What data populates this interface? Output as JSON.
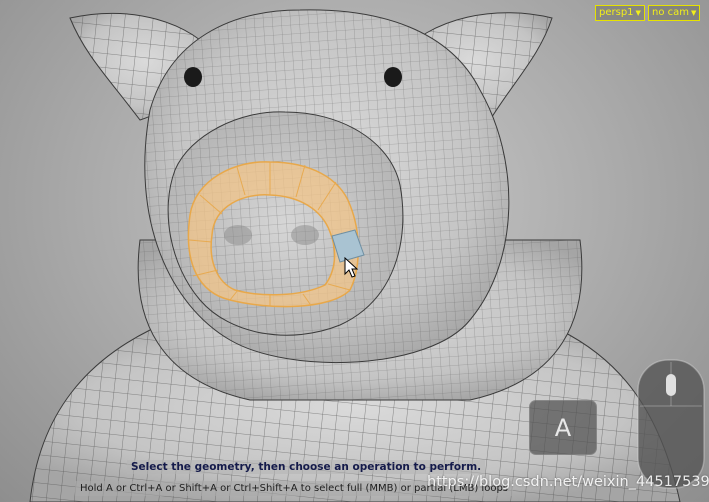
{
  "viewport": {
    "camera_menu": {
      "label": "persp1",
      "color": "#f2ee1a"
    },
    "view_menu": {
      "label": "no cam",
      "color": "#f2ee1a"
    },
    "selection_color": "#f1c488",
    "highlight_color": "#a9c3d2",
    "model": "pig-head-wireframe-mesh"
  },
  "key_hint": {
    "label": "A"
  },
  "mouse_hint": {
    "icon": "mouse-icon",
    "highlight_button": "middle"
  },
  "help_line": {
    "primary": "Select the geometry, then choose an operation to perform.",
    "secondary": "Hold A or Ctrl+A or Shift+A or Ctrl+Shift+A to select full (MMB) or partial (LMB) loops"
  },
  "watermark": {
    "text": "https://blog.csdn.net/weixin_44517539"
  }
}
